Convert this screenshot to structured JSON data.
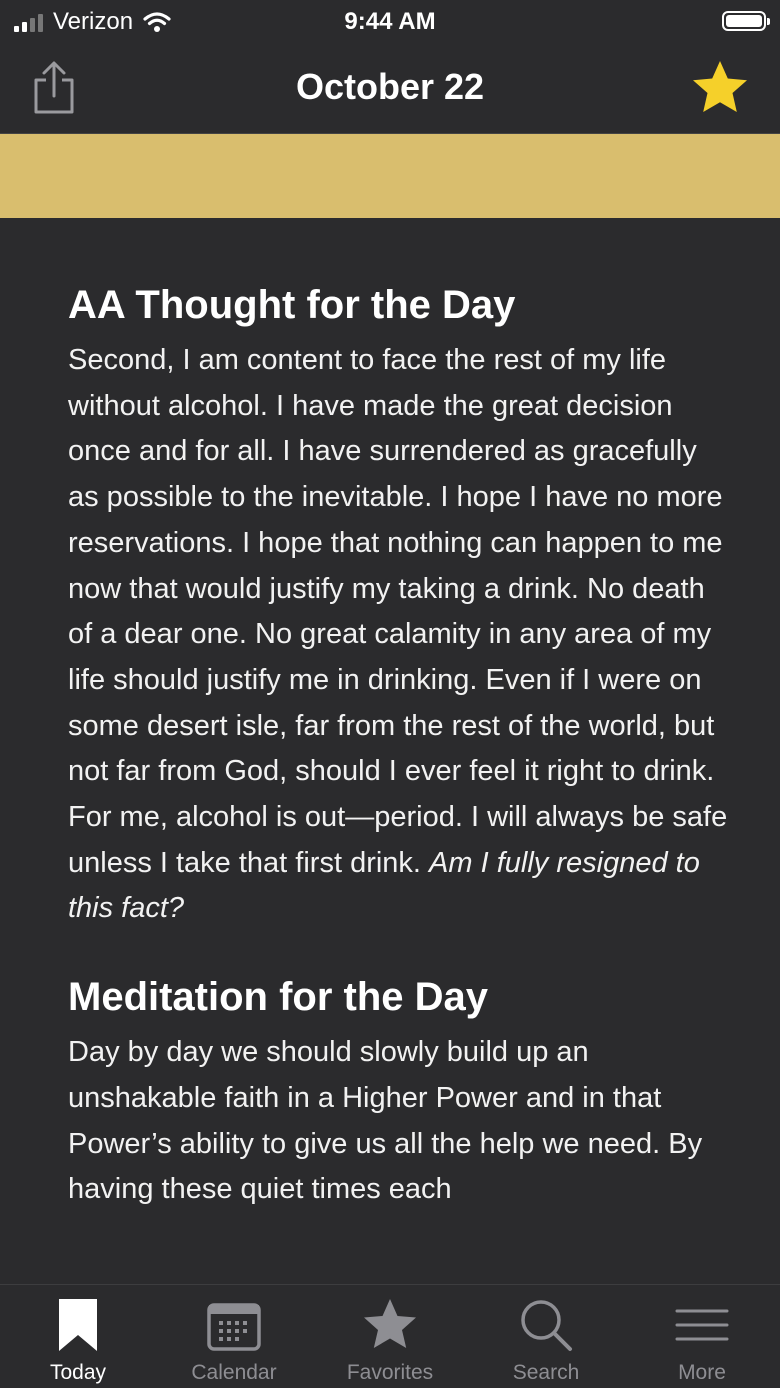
{
  "status": {
    "carrier": "Verizon",
    "time": "9:44 AM"
  },
  "header": {
    "title": "October 22"
  },
  "sections": [
    {
      "heading": "AA Thought for the Day",
      "body": "Second, I am content to face the rest of my life without alcohol. I have made the great decision once and for all. I have surrendered as gracefully as possible to the inevitable. I hope I have no more reservations. I hope that nothing can happen to me now that would justify my taking a drink. No death of a dear one. No great calamity in any area of my life should justify me in drinking. Even if I were on some desert isle, far from the rest of the world, but not far from God, should I ever feel it right to drink. For me, alcohol is out—period. I will always be safe unless I take that first drink.",
      "italic": "Am I fully resigned to this fact?"
    },
    {
      "heading": "Meditation for the Day",
      "body": "Day by day we should slowly build up an unshakable faith in a Higher Power and in that Power’s ability to give us all the help we need. By having these quiet times each"
    }
  ],
  "tabs": [
    {
      "label": "Today",
      "icon": "bookmark-icon",
      "active": true
    },
    {
      "label": "Calendar",
      "icon": "calendar-icon"
    },
    {
      "label": "Favorites",
      "icon": "star-icon"
    },
    {
      "label": "Search",
      "icon": "search-icon"
    },
    {
      "label": "More",
      "icon": "menu-icon"
    }
  ],
  "colors": {
    "background": "#2b2b2d",
    "banner": "#d9be6e",
    "star": "#f5d02a"
  }
}
